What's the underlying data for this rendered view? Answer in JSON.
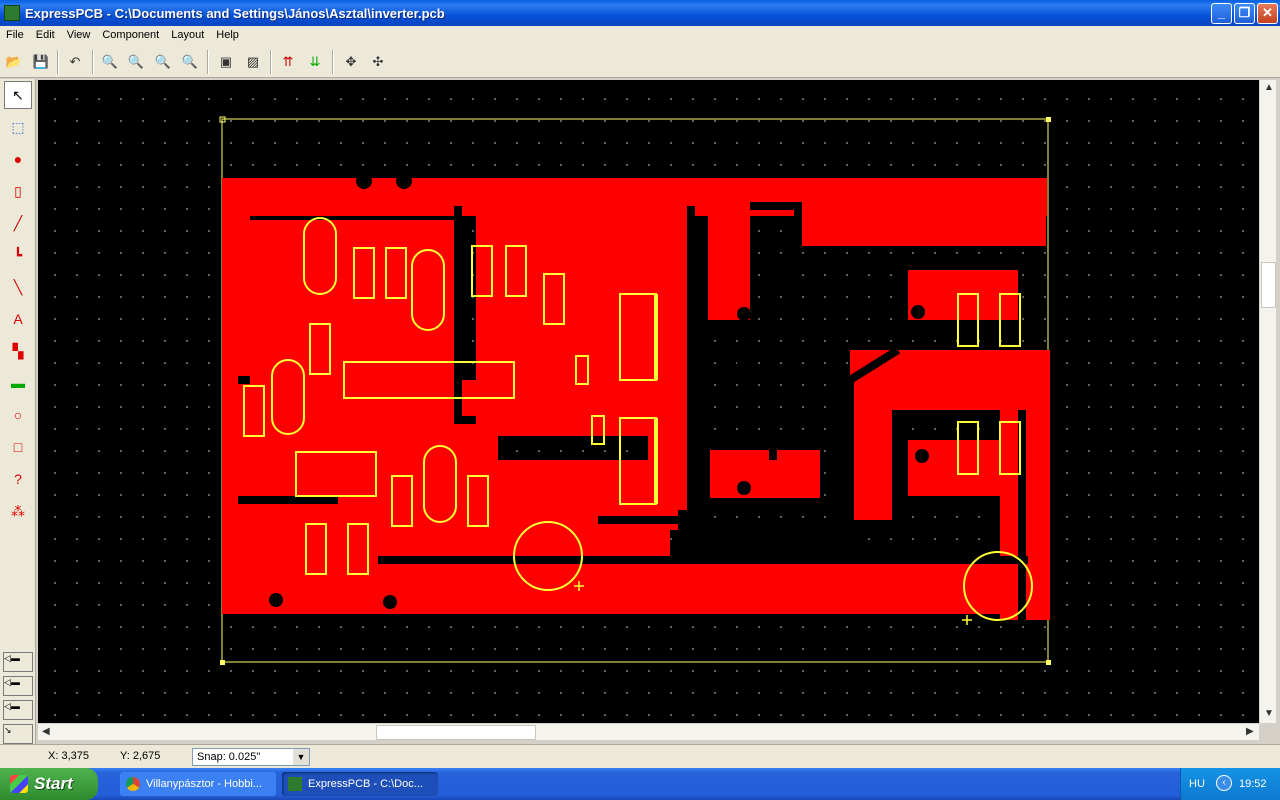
{
  "window": {
    "title": "ExpressPCB - C:\\Documents and Settings\\János\\Asztal\\inverter.pcb"
  },
  "menu": [
    "File",
    "Edit",
    "View",
    "Component",
    "Layout",
    "Help"
  ],
  "status": {
    "x": "X: 3,375",
    "y": "Y: 2,675",
    "snap": "Snap:  0.025\""
  },
  "taskbar": {
    "start": "Start",
    "tasks": [
      "Villanypásztor - Hobbi...",
      "ExpressPCB - C:\\Doc..."
    ],
    "lang": "HU",
    "clock": "19:52"
  },
  "colors": {
    "copper": "#ff0000",
    "silk": "#ffff33",
    "board": "#000000",
    "grid": "#6a6a6a"
  }
}
